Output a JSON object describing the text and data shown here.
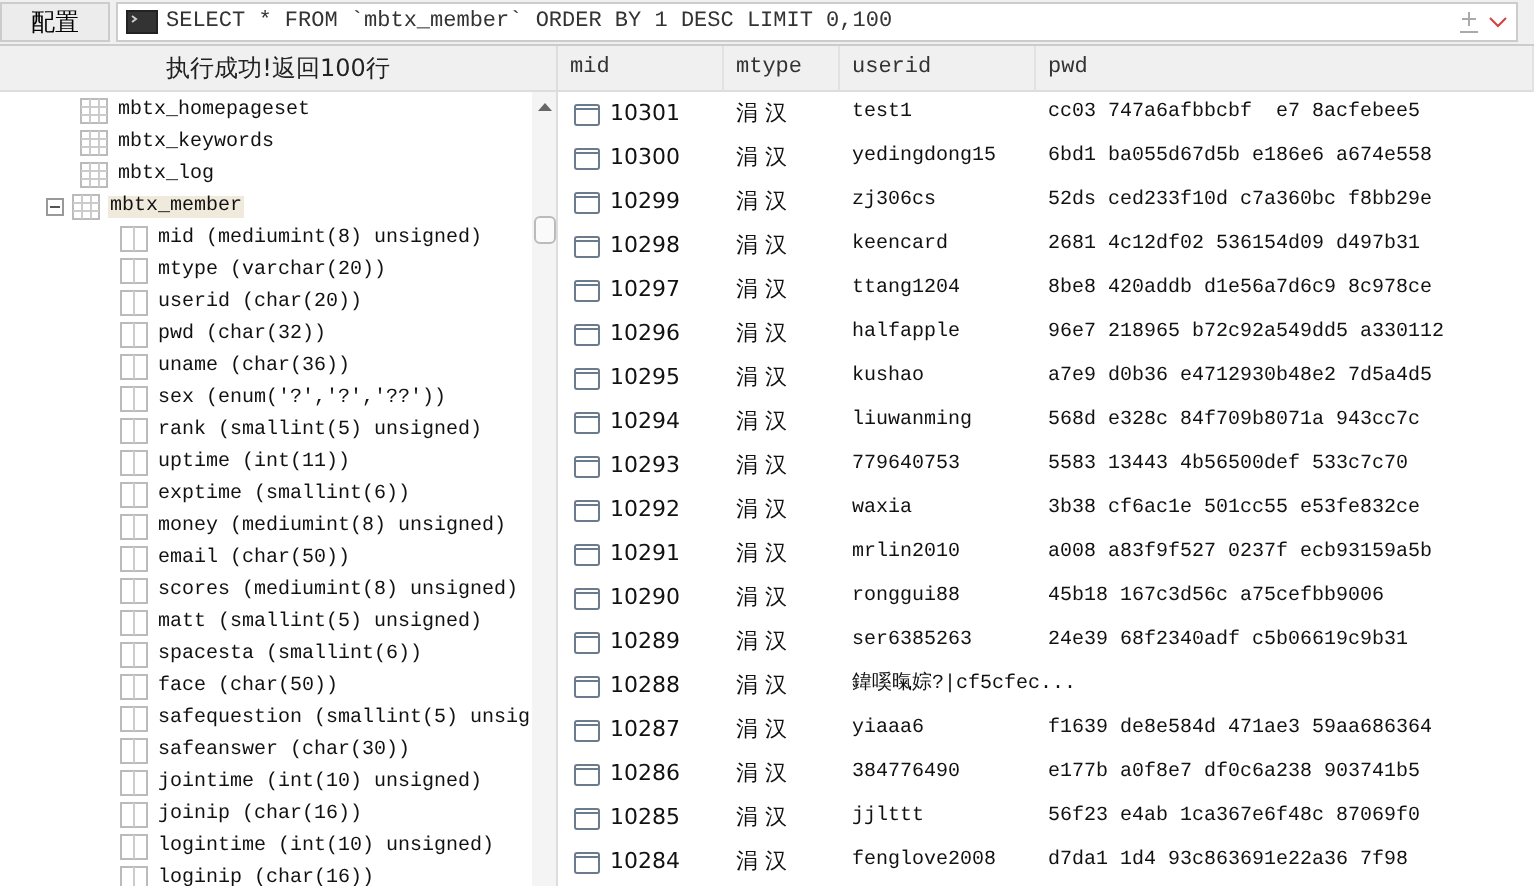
{
  "toolbar": {
    "config_button": "配置",
    "query": "SELECT * FROM `mbtx_member` ORDER BY 1 DESC LIMIT 0,100"
  },
  "status": "执行成功!返回100行",
  "tree": [
    {
      "label": "mbtx_homepageset",
      "kind": "table",
      "expanded": false,
      "selected": false
    },
    {
      "label": "mbtx_keywords",
      "kind": "table",
      "expanded": false,
      "selected": false
    },
    {
      "label": "mbtx_log",
      "kind": "table",
      "expanded": false,
      "selected": false
    },
    {
      "label": "mbtx_member",
      "kind": "table",
      "expanded": true,
      "selected": true,
      "children": [
        {
          "label": "mid (mediumint(8) unsigned)",
          "kind": "column"
        },
        {
          "label": "mtype (varchar(20))",
          "kind": "column"
        },
        {
          "label": "userid (char(20))",
          "kind": "column"
        },
        {
          "label": "pwd (char(32))",
          "kind": "column"
        },
        {
          "label": "uname (char(36))",
          "kind": "column"
        },
        {
          "label": "sex (enum('?','?','??'))",
          "kind": "column"
        },
        {
          "label": "rank (smallint(5) unsigned)",
          "kind": "column"
        },
        {
          "label": "uptime (int(11))",
          "kind": "column"
        },
        {
          "label": "exptime (smallint(6))",
          "kind": "column"
        },
        {
          "label": "money (mediumint(8) unsigned)",
          "kind": "column"
        },
        {
          "label": "email (char(50))",
          "kind": "column"
        },
        {
          "label": "scores (mediumint(8) unsigned)",
          "kind": "column"
        },
        {
          "label": "matt (smallint(5) unsigned)",
          "kind": "column"
        },
        {
          "label": "spacesta (smallint(6))",
          "kind": "column"
        },
        {
          "label": "face (char(50))",
          "kind": "column"
        },
        {
          "label": "safequestion (smallint(5) unsig",
          "kind": "column"
        },
        {
          "label": "safeanswer (char(30))",
          "kind": "column"
        },
        {
          "label": "jointime (int(10) unsigned)",
          "kind": "column"
        },
        {
          "label": "joinip (char(16))",
          "kind": "column"
        },
        {
          "label": "logintime (int(10) unsigned)",
          "kind": "column"
        },
        {
          "label": "loginip (char(16))",
          "kind": "column"
        }
      ]
    }
  ],
  "table": {
    "columns": [
      "mid",
      "mtype",
      "userid",
      "pwd"
    ],
    "rows": [
      {
        "mid": "10301",
        "mtype": "涓 汉",
        "userid": "test1",
        "pwd": "cc03 747a6afbbcbf  e7 8acfebee5"
      },
      {
        "mid": "10300",
        "mtype": "涓 汉",
        "userid": "yedingdong15",
        "pwd": "6bd1 ba055d67d5b e186e6 a674e558"
      },
      {
        "mid": "10299",
        "mtype": "涓 汉",
        "userid": "zj306cs",
        "pwd": "52ds ced233f10d c7a360bc f8bb29e"
      },
      {
        "mid": "10298",
        "mtype": "涓 汉",
        "userid": "keencard",
        "pwd": "2681 4c12df02 536154d09 d497b31"
      },
      {
        "mid": "10297",
        "mtype": "涓 汉",
        "userid": "ttang1204",
        "pwd": "8be8 420addb d1e56a7d6c9 8c978ce"
      },
      {
        "mid": "10296",
        "mtype": "涓 汉",
        "userid": "halfapple",
        "pwd": "96e7 218965 b72c92a549dd5 a330112"
      },
      {
        "mid": "10295",
        "mtype": "涓 汉",
        "userid": "kushao",
        "pwd": "a7e9 d0b36 e4712930b48e2 7d5a4d5"
      },
      {
        "mid": "10294",
        "mtype": "涓 汉",
        "userid": "liuwanming",
        "pwd": "568d e328c 84f709b8071a 943cc7c"
      },
      {
        "mid": "10293",
        "mtype": "涓 汉",
        "userid": "779640753",
        "pwd": "5583 13443 4b56500def 533c7c70"
      },
      {
        "mid": "10292",
        "mtype": "涓 汉",
        "userid": "waxia",
        "pwd": "3b38 cf6ac1e 501cc55 e53fe832ce"
      },
      {
        "mid": "10291",
        "mtype": "涓 汉",
        "userid": "mrlin2010",
        "pwd": "a008 a83f9f527 0237f ecb93159a5b"
      },
      {
        "mid": "10290",
        "mtype": "涓 汉",
        "userid": "ronggui88",
        "pwd": "45b18 167c3d56c a75cefbb9006"
      },
      {
        "mid": "10289",
        "mtype": "涓 汉",
        "userid": "ser6385263",
        "pwd": "24e39 68f2340adf c5b06619c9b31"
      },
      {
        "mid": "10288",
        "mtype": "涓 汉",
        "userid": "鍏嗘暣婃?|cf5cfec..."
      },
      {
        "mid": "10287",
        "mtype": "涓 汉",
        "userid": "yiaaa6",
        "pwd": "f1639 de8e584d 471ae3 59aa686364"
      },
      {
        "mid": "10286",
        "mtype": "涓 汉",
        "userid": "384776490",
        "pwd": "e177b a0f8e7 df0c6a238 903741b5"
      },
      {
        "mid": "10285",
        "mtype": "涓 汉",
        "userid": "jjlttt",
        "pwd": "56f23 e4ab 1ca367e6f48c 87069f0"
      },
      {
        "mid": "10284",
        "mtype": "涓 汉",
        "userid": "fenglove2008",
        "pwd": "d7da1 1d4 93c863691e22a36 7f98"
      }
    ]
  }
}
